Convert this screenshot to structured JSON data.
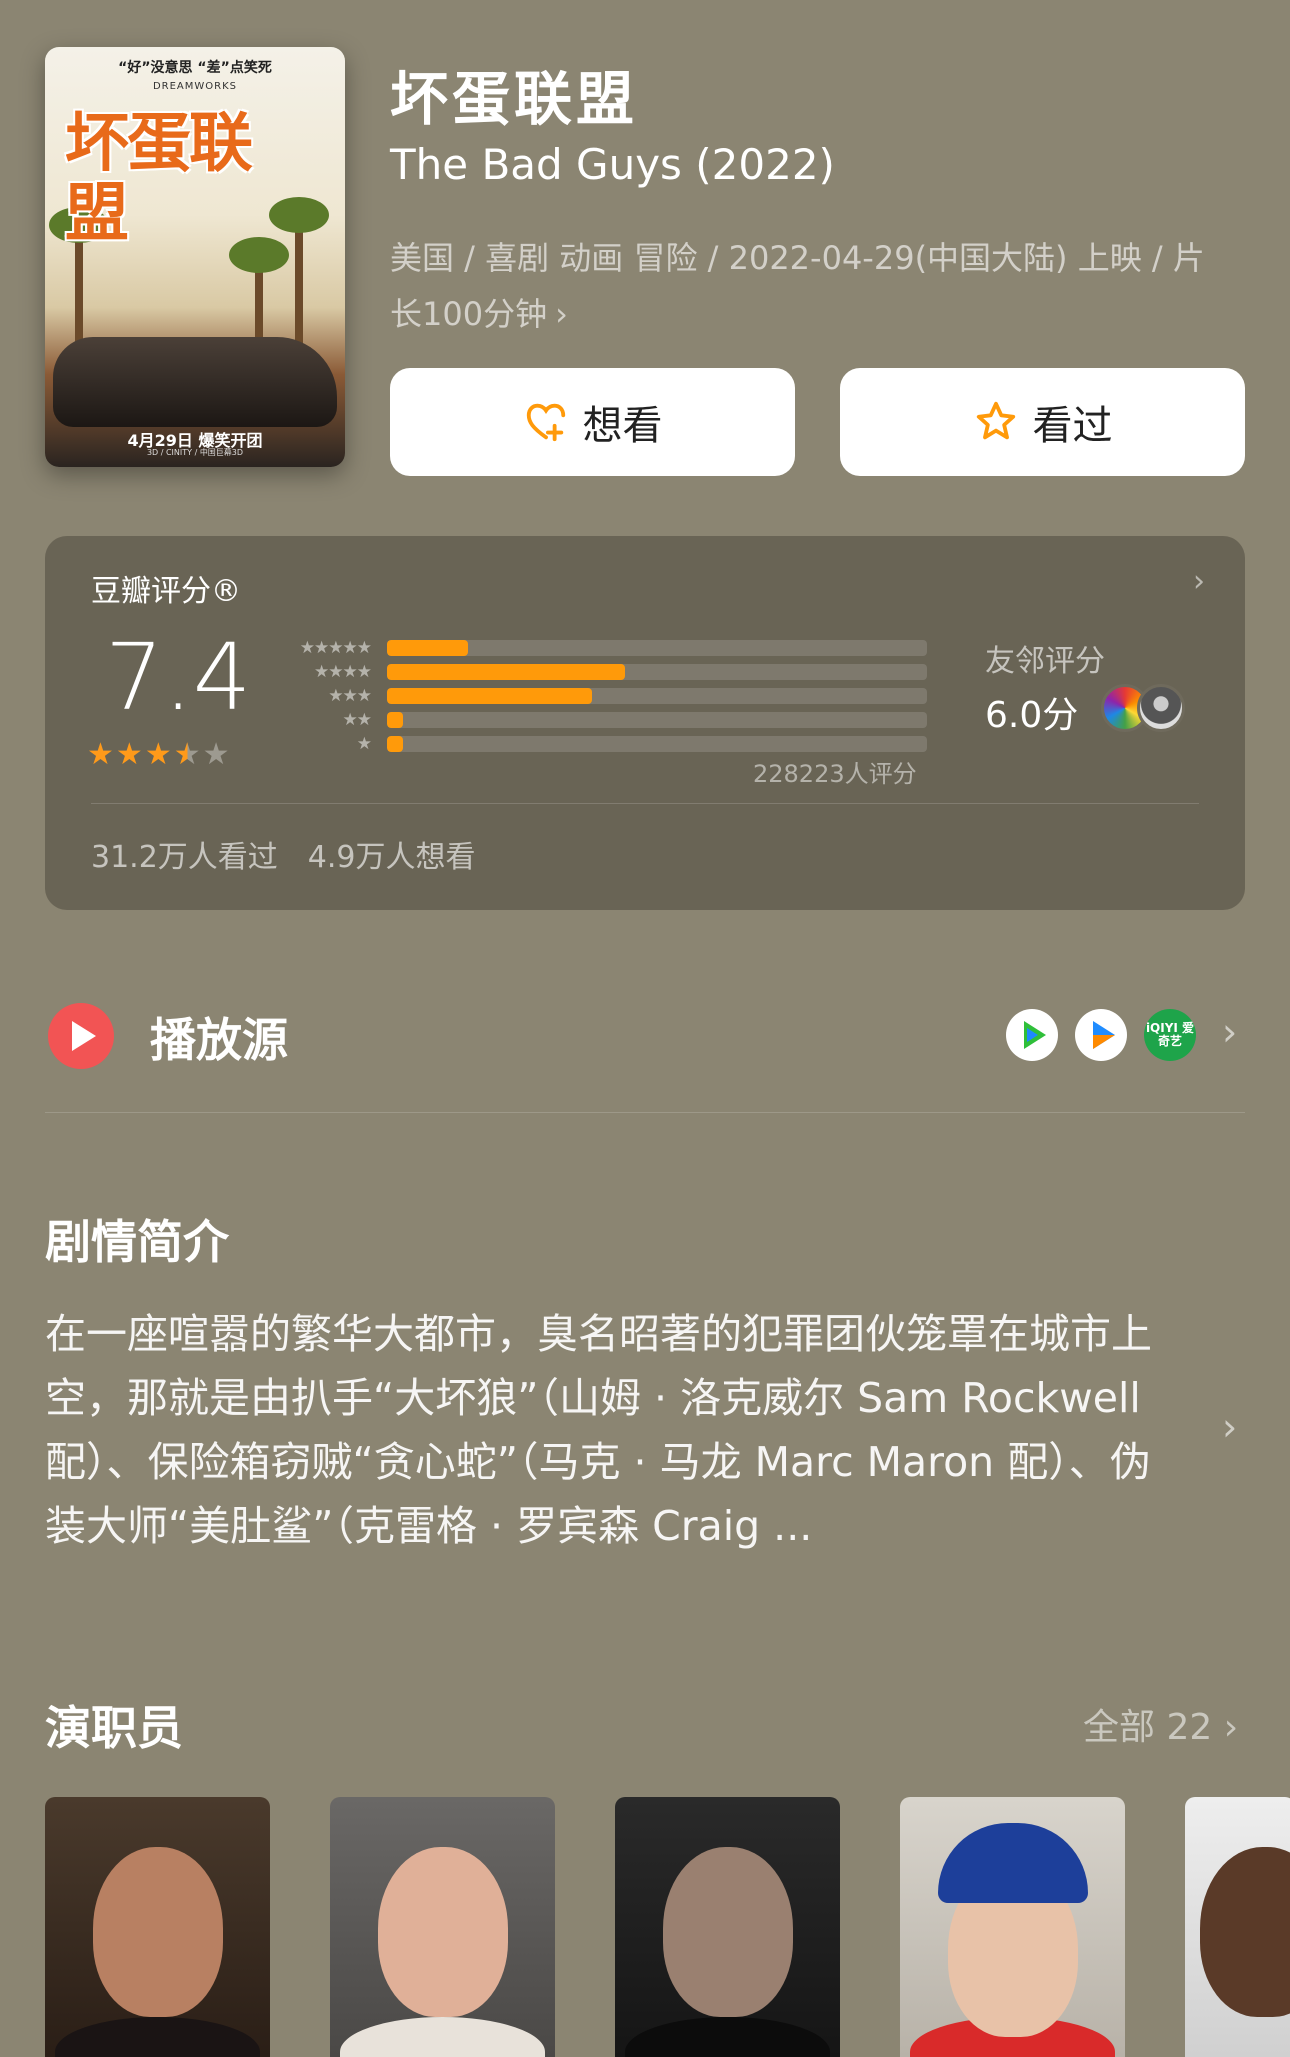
{
  "movie": {
    "title_cn": "坏蛋联盟",
    "title_en": "The Bad Guys (2022)",
    "meta_line": "美国 / 喜剧 动画 冒险 / 2022-04-29(中国大陆) 上映 / 片长100分钟",
    "poster": {
      "tagline": "“好”没意思 “差”点笑死",
      "studio": "DREAMWORKS",
      "title": "坏蛋联盟",
      "date": "4月29日 爆笑开团",
      "formats": "3D / CINITY / 中国巨幕3D"
    }
  },
  "actions": {
    "want_label": "想看",
    "seen_label": "看过"
  },
  "rating": {
    "label": "豆瓣评分®",
    "score": "7.4",
    "stars_value": 3.5,
    "distribution": [
      {
        "stars": "★★★★★",
        "pct": 15
      },
      {
        "stars": "★★★★",
        "pct": 44
      },
      {
        "stars": "★★★",
        "pct": 38
      },
      {
        "stars": "★★",
        "pct": 3
      },
      {
        "stars": "★",
        "pct": 3
      }
    ],
    "count_text": "228223人评分",
    "friend_label": "友邻评分",
    "friend_score": "6.0分",
    "watched": "31.2万人看过",
    "want": "4.9万人想看",
    "accent": "#ff9a0a"
  },
  "play": {
    "label": "播放源",
    "sources": [
      "tencent-video-icon",
      "youku-icon",
      "iqiyi-icon"
    ],
    "iqiyi_text": "iQIYI 爱奇艺"
  },
  "synopsis": {
    "heading": "剧情简介",
    "text": "在一座喧嚣的繁华大都市，臭名昭著的犯罪团伙笼罩在城市上空，那就是由扒手“大坏狼”（山姆 · 洛克威尔 Sam Rockwell 配）、保险箱窃贼“贪心蛇”（马克 · 马龙 Marc Maron 配）、伪装大师“美肚鲨”（克雷格 · 罗宾森 Craig ..."
  },
  "cast": {
    "heading": "演职员",
    "all_label": "全部 22"
  }
}
